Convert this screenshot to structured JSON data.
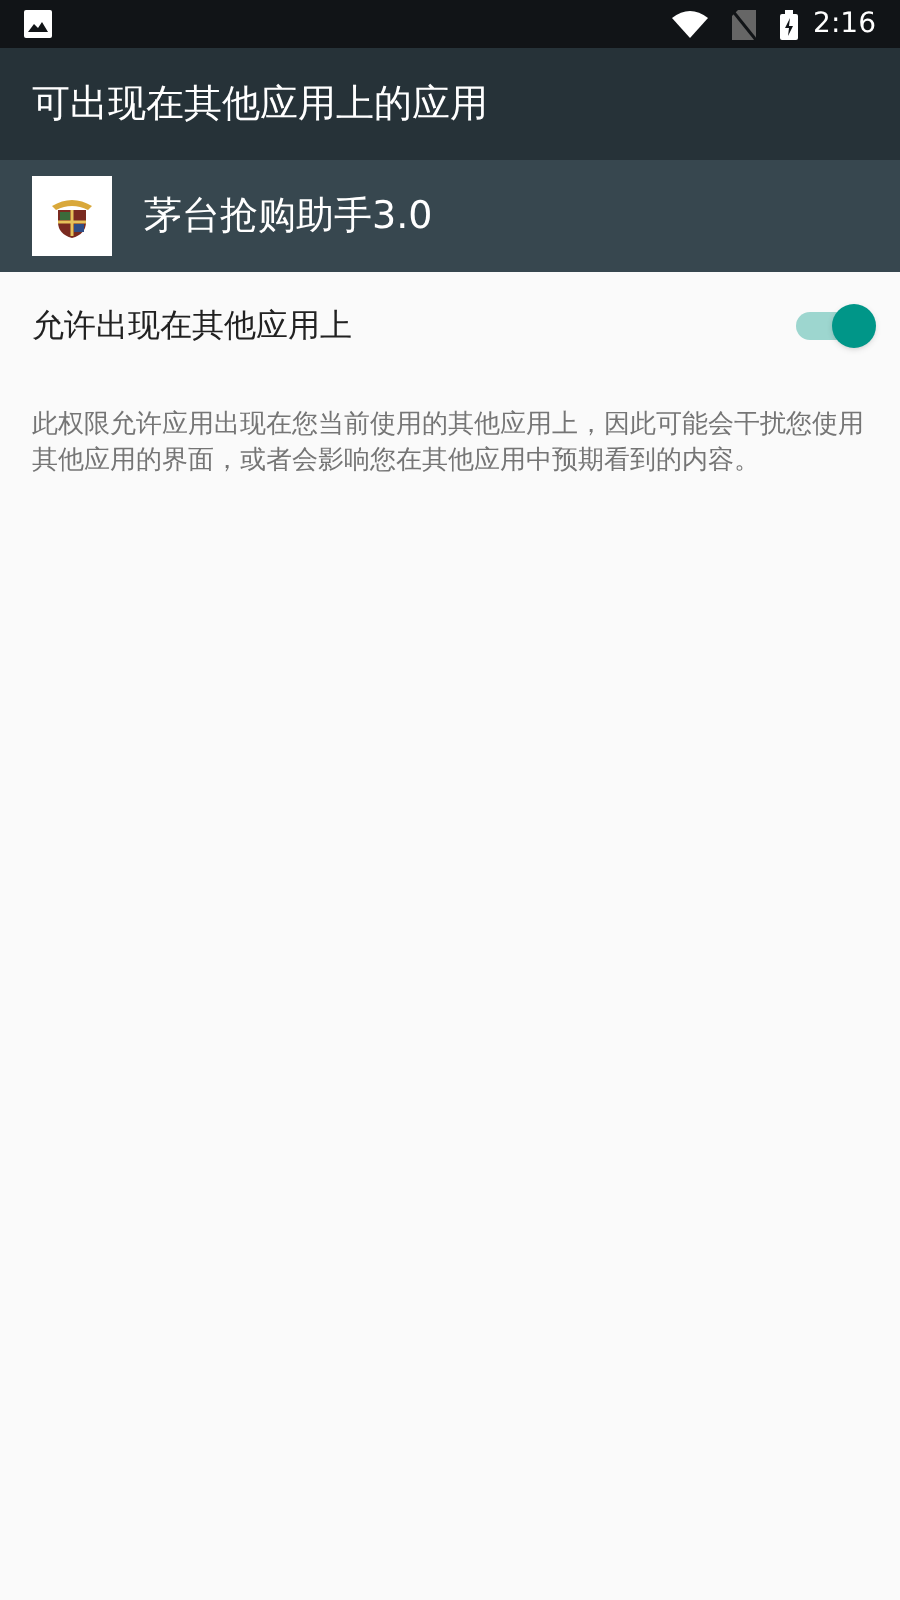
{
  "status_bar": {
    "time": "2:16"
  },
  "toolbar": {
    "title": "可出现在其他应用上的应用"
  },
  "app_header": {
    "name": "茅台抢购助手3.0"
  },
  "setting": {
    "label": "允许出现在其他应用上",
    "on": true
  },
  "description": "此权限允许应用出现在您当前使用的其他应用上，因此可能会干扰您使用其他应用的界面，或者会影响您在其他应用中预期看到的内容。"
}
